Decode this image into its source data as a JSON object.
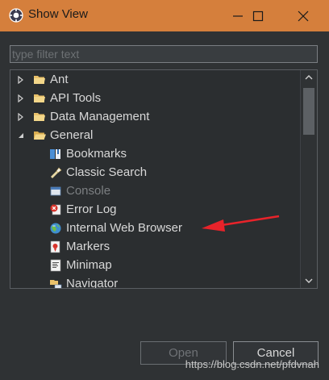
{
  "window": {
    "title": "Show View",
    "controls": {
      "minimize": "minimize",
      "maximize": "maximize",
      "close": "close"
    }
  },
  "filter": {
    "placeholder": "type filter text",
    "value": ""
  },
  "tree": {
    "items": [
      {
        "label": "Ant",
        "level": 0,
        "state": "collapsed",
        "icon": "folder-icon"
      },
      {
        "label": "API Tools",
        "level": 0,
        "state": "collapsed",
        "icon": "folder-icon"
      },
      {
        "label": "Data Management",
        "level": 0,
        "state": "collapsed",
        "icon": "folder-icon"
      },
      {
        "label": "General",
        "level": 0,
        "state": "expanded",
        "icon": "folder-open-icon"
      },
      {
        "label": "Bookmarks",
        "level": 1,
        "icon": "bookmarks-icon"
      },
      {
        "label": "Classic Search",
        "level": 1,
        "icon": "search-flashlight-icon"
      },
      {
        "label": "Console",
        "level": 1,
        "icon": "console-icon",
        "disabled": true
      },
      {
        "label": "Error Log",
        "level": 1,
        "icon": "error-log-icon"
      },
      {
        "label": "Internal Web Browser",
        "level": 1,
        "icon": "globe-icon"
      },
      {
        "label": "Markers",
        "level": 1,
        "icon": "markers-icon"
      },
      {
        "label": "Minimap",
        "level": 1,
        "icon": "minimap-icon"
      },
      {
        "label": "Navigator",
        "level": 1,
        "icon": "navigator-icon"
      }
    ]
  },
  "buttons": {
    "open": "Open",
    "cancel": "Cancel"
  },
  "watermark": "https://blog.csdn.net/pfdvnah",
  "colors": {
    "titlebar": "#d57f3c",
    "annotation_arrow": "#e8232a"
  }
}
